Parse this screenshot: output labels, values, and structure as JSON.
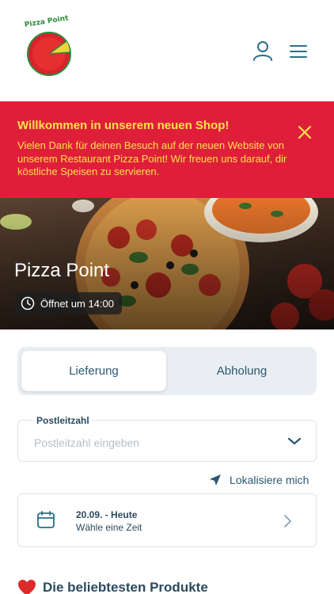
{
  "header": {
    "logo_text": "Pizza Point",
    "icons": {
      "account": "user-icon",
      "menu": "menu-icon"
    }
  },
  "banner": {
    "title": "Willkommen in unserem neuen Shop!",
    "text": "Vielen Dank für deinen Besuch auf der neuen Website von unserem Restaurant Pizza Point! Wir freuen uns darauf, dir köstliche Speisen zu servieren.",
    "close_icon": "close-icon",
    "colors": {
      "background": "#df1f3a",
      "text": "#ffe14a"
    }
  },
  "hero": {
    "restaurant_name": "Pizza Point",
    "opening": "Öffnet um 14:00",
    "clock_icon": "clock-icon"
  },
  "tabs": [
    {
      "label": "Lieferung",
      "active": true
    },
    {
      "label": "Abholung",
      "active": false
    }
  ],
  "postal": {
    "label": "Postleitzahl",
    "placeholder": "Postleitzahl eingeben",
    "value": ""
  },
  "locate": {
    "label": "Lokalisiere mich",
    "icon": "location-arrow-icon"
  },
  "date": {
    "line1": "20.09. - Heute",
    "line2": "Wähle eine Zeit",
    "icon": "calendar-icon"
  },
  "popular": {
    "title": "Die beliebtesten Produkte",
    "icon": "heart-icon"
  },
  "colors": {
    "accent": "#2b5872",
    "text": "#2b4a5c"
  }
}
